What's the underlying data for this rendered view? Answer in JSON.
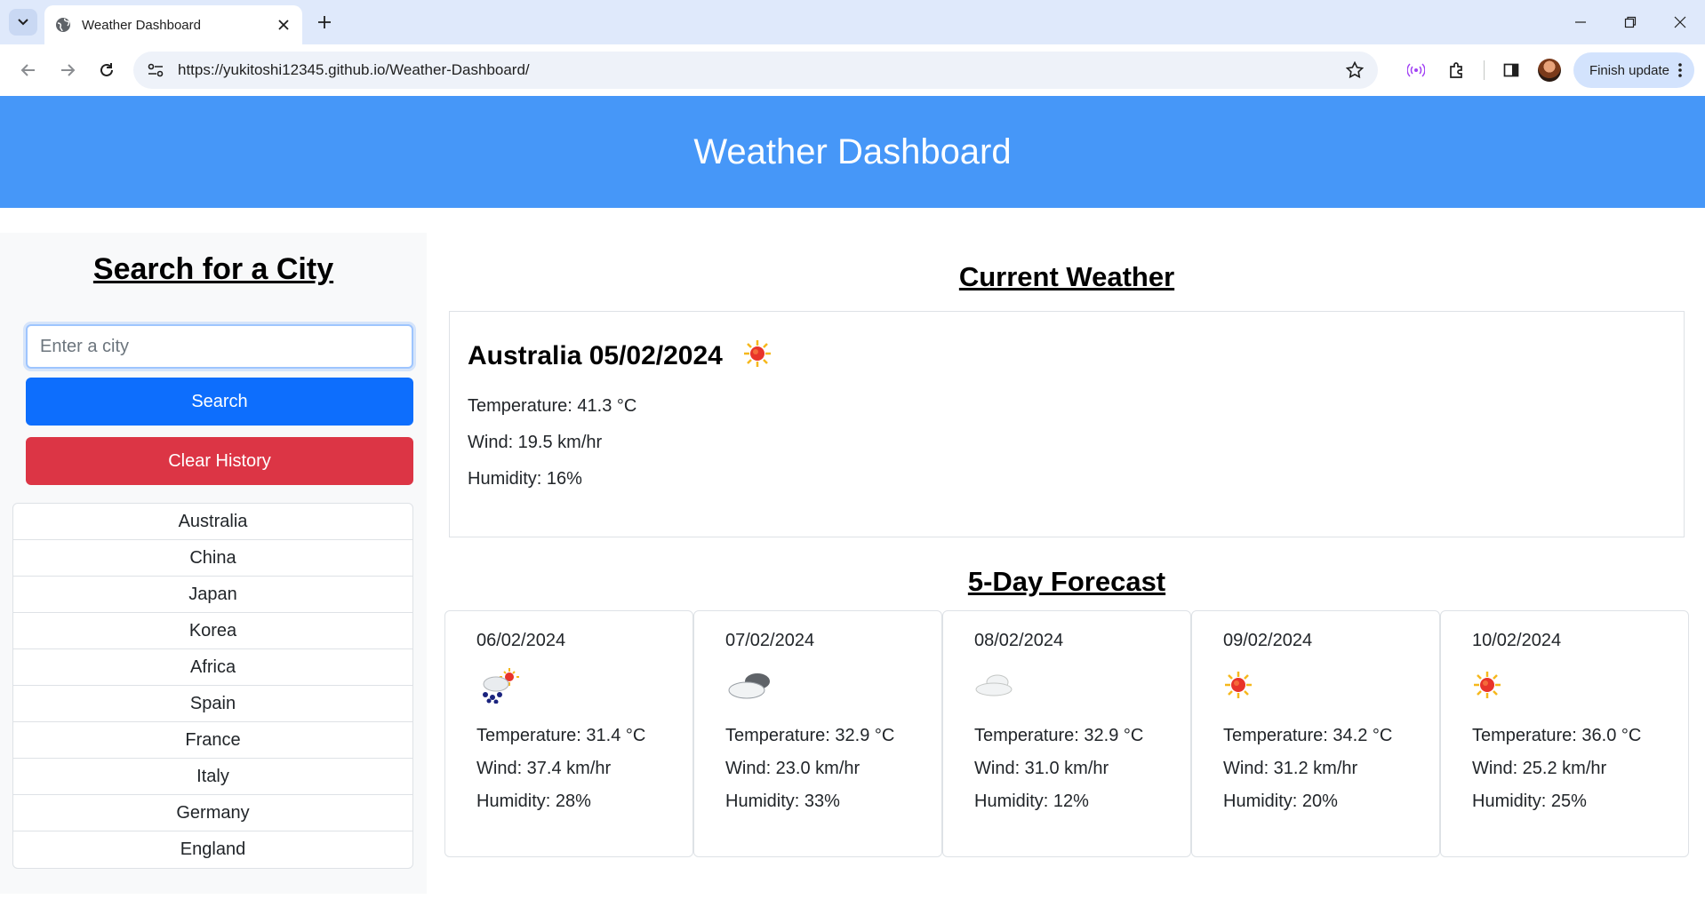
{
  "browser": {
    "tab_title": "Weather Dashboard",
    "url": "https://yukitoshi12345.github.io/Weather-Dashboard/",
    "finish_update_label": "Finish update"
  },
  "page": {
    "header_title": "Weather Dashboard",
    "sidebar": {
      "title": "Search for a City",
      "input_placeholder": "Enter a city",
      "input_value": "",
      "search_label": "Search",
      "clear_label": "Clear History",
      "history": [
        "Australia",
        "China",
        "Japan",
        "Korea",
        "Africa",
        "Spain",
        "France",
        "Italy",
        "Germany",
        "England"
      ]
    },
    "current": {
      "section_title": "Current Weather",
      "heading": "Australia 05/02/2024",
      "icon": "sunny-icon",
      "temperature": "Temperature: 41.3 °C",
      "wind": "Wind: 19.5 km/hr",
      "humidity": "Humidity: 16%"
    },
    "forecast": {
      "section_title": "5-Day Forecast",
      "days": [
        {
          "date": "06/02/2024",
          "icon": "rain-sun-icon",
          "temperature": "Temperature: 31.4 °C",
          "wind": "Wind: 37.4 km/hr",
          "humidity": "Humidity: 28%"
        },
        {
          "date": "07/02/2024",
          "icon": "broken-clouds-icon",
          "temperature": "Temperature: 32.9 °C",
          "wind": "Wind: 23.0 km/hr",
          "humidity": "Humidity: 33%"
        },
        {
          "date": "08/02/2024",
          "icon": "cloud-icon",
          "temperature": "Temperature: 32.9 °C",
          "wind": "Wind: 31.0 km/hr",
          "humidity": "Humidity: 12%"
        },
        {
          "date": "09/02/2024",
          "icon": "sunny-icon",
          "temperature": "Temperature: 34.2 °C",
          "wind": "Wind: 31.2 km/hr",
          "humidity": "Humidity: 20%"
        },
        {
          "date": "10/02/2024",
          "icon": "sunny-icon",
          "temperature": "Temperature: 36.0 °C",
          "wind": "Wind: 25.2 km/hr",
          "humidity": "Humidity: 25%"
        }
      ]
    }
  },
  "colors": {
    "header_bg": "#4697f8",
    "search_btn": "#0d6efd",
    "clear_btn": "#dc3545",
    "browser_frame": "#dfe9fb"
  }
}
